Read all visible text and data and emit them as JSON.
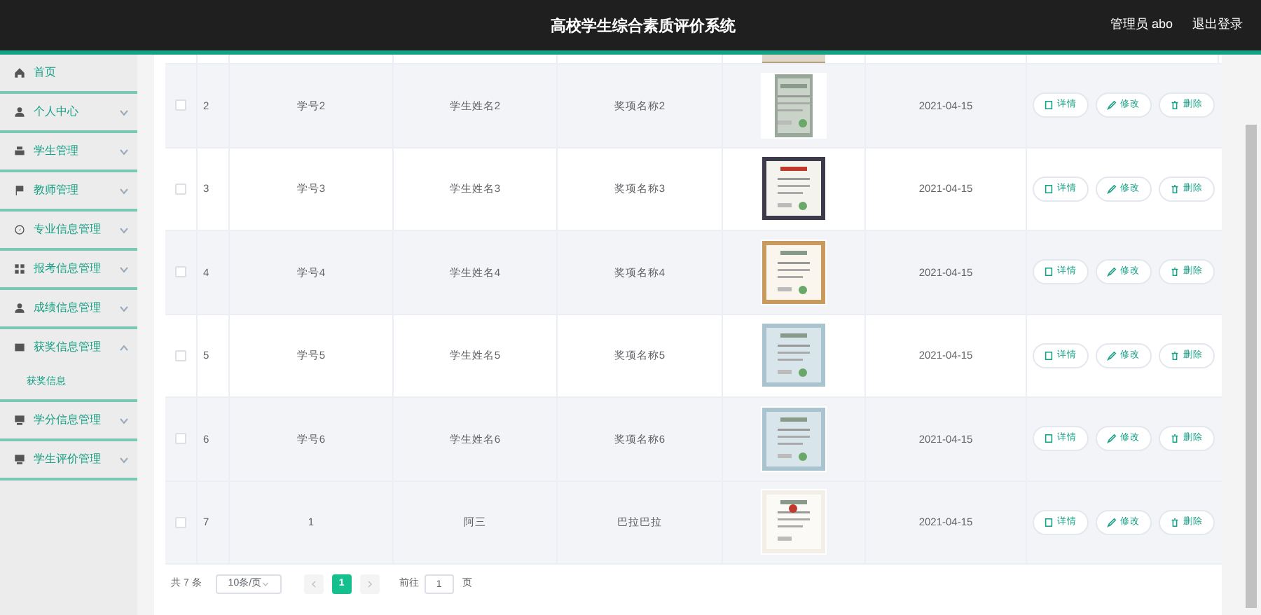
{
  "header": {
    "title": "高校学生综合素质评价系统",
    "user": "管理员 abo",
    "logout": "退出登录"
  },
  "sidebar": {
    "items": [
      {
        "label": "首页"
      },
      {
        "label": "个人中心",
        "expanded": false
      },
      {
        "label": "学生管理",
        "expanded": false
      },
      {
        "label": "教师管理",
        "expanded": false
      },
      {
        "label": "专业信息管理",
        "expanded": false
      },
      {
        "label": "报考信息管理",
        "expanded": false
      },
      {
        "label": "成绩信息管理",
        "expanded": false
      },
      {
        "label": "获奖信息管理",
        "expanded": true,
        "children": [
          {
            "label": "获奖信息",
            "selected": true
          }
        ]
      },
      {
        "label": "学分信息管理",
        "expanded": false
      },
      {
        "label": "学生评价管理",
        "expanded": false
      }
    ]
  },
  "table": {
    "rows": [
      {
        "index": "2",
        "student_no": "学号2",
        "student_name": "学生姓名2",
        "award": "奖项名称2",
        "date": "2021-04-15",
        "shaded": true,
        "checked": false,
        "actions": [
          "详情",
          "修改",
          "删除"
        ]
      },
      {
        "index": "3",
        "student_no": "学号3",
        "student_name": "学生姓名3",
        "award": "奖项名称3",
        "date": "2021-04-15",
        "shaded": false,
        "checked": false,
        "actions": [
          "详情",
          "修改",
          "删除"
        ]
      },
      {
        "index": "4",
        "student_no": "学号4",
        "student_name": "学生姓名4",
        "award": "奖项名称4",
        "date": "2021-04-15",
        "shaded": true,
        "checked": false,
        "actions": [
          "详情",
          "修改",
          "删除"
        ]
      },
      {
        "index": "5",
        "student_no": "学号5",
        "student_name": "学生姓名5",
        "award": "奖项名称5",
        "date": "2021-04-15",
        "shaded": false,
        "checked": false,
        "actions": [
          "详情",
          "修改",
          "删除"
        ]
      },
      {
        "index": "6",
        "student_no": "学号6",
        "student_name": "学生姓名6",
        "award": "奖项名称6",
        "date": "2021-04-15",
        "shaded": true,
        "checked": false,
        "actions": [
          "详情",
          "修改",
          "删除"
        ]
      },
      {
        "index": "7",
        "student_no": "1",
        "student_name": "阿三",
        "award": "巴拉巴拉",
        "date": "2021-04-15",
        "shaded": true,
        "checked": false,
        "actions": [
          "详情",
          "修改",
          "删除"
        ]
      }
    ]
  },
  "pagination": {
    "total": "共 7 条",
    "page_size": "10条/页",
    "pages": [
      {
        "label": "1",
        "selected": true
      }
    ],
    "goto_label": "前往",
    "goto_value": "1",
    "goto_suffix": "页"
  }
}
